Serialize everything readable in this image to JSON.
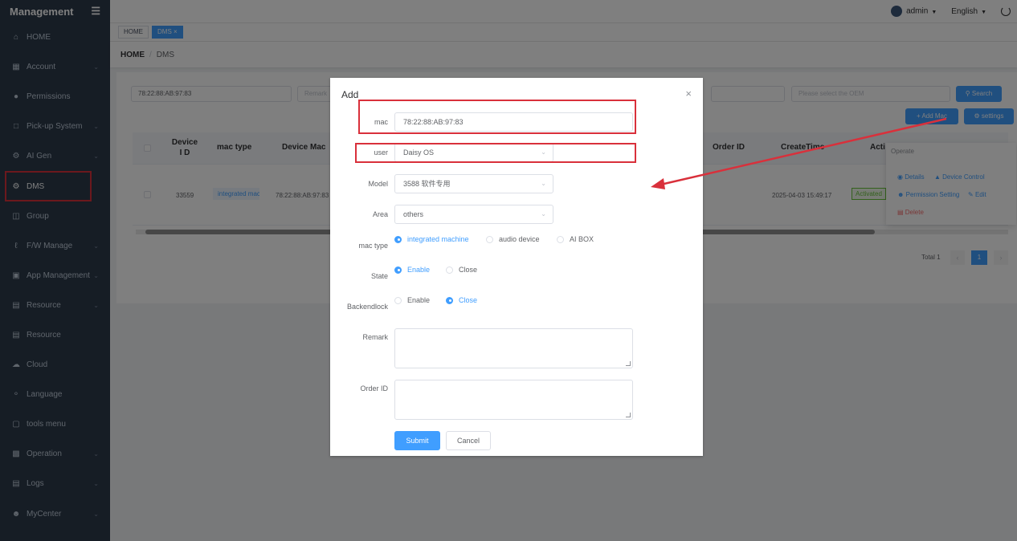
{
  "sidebar": {
    "title": "Management",
    "items": [
      {
        "label": "HOME",
        "icon": "home-icon",
        "chev": false
      },
      {
        "label": "Account",
        "icon": "grid-icon",
        "chev": true
      },
      {
        "label": "Permissions",
        "icon": "user-icon",
        "chev": false
      },
      {
        "label": "Pick-up System",
        "icon": "screen-icon",
        "chev": true
      },
      {
        "label": "AI Gen",
        "icon": "ai-icon",
        "chev": true
      },
      {
        "label": "DMS",
        "icon": "gear-icon",
        "chev": false
      },
      {
        "label": "Group",
        "icon": "folder-icon",
        "chev": false
      },
      {
        "label": "F/W Manage",
        "icon": "wrench-icon",
        "chev": true
      },
      {
        "label": "App Management",
        "icon": "app-icon",
        "chev": true
      },
      {
        "label": "Resource",
        "icon": "stack-icon",
        "chev": true
      },
      {
        "label": "Resource",
        "icon": "stack-icon",
        "chev": false
      },
      {
        "label": "Cloud",
        "icon": "cloud-icon",
        "chev": false
      },
      {
        "label": "Language",
        "icon": "mic-icon",
        "chev": false
      },
      {
        "label": "tools menu",
        "icon": "toolbox-icon",
        "chev": false
      },
      {
        "label": "Operation",
        "icon": "operation-icon",
        "chev": true
      },
      {
        "label": "Logs",
        "icon": "log-icon",
        "chev": true
      },
      {
        "label": "MyCenter",
        "icon": "person-icon",
        "chev": true
      }
    ]
  },
  "topbar": {
    "user": "admin",
    "language": "English"
  },
  "tags": {
    "home": "HOME",
    "dms": "DMS ×"
  },
  "breadcrumb": {
    "home": "HOME",
    "current": "DMS"
  },
  "filters": {
    "mac": "78:22:88:AB:97:83",
    "remark_placeholder": "Remark",
    "oem_placeholder": "Please select the OEM",
    "search": "Search",
    "add_mac": "+ Add Mac",
    "settings": "settings"
  },
  "table": {
    "headers": {
      "device_id": "Device I D",
      "mac_type": "mac type",
      "device_mac": "Device Mac",
      "order_id": "Order ID",
      "create_time": "CreateTime",
      "action": "Acti"
    },
    "row": {
      "device_id": "33559",
      "mac_type": "integrated mac",
      "device_mac": "78:22:88:AB:97:83",
      "create_time": "2025-04-03 15:49:17",
      "status": "Activated"
    }
  },
  "operate_menu": {
    "title": "Operate",
    "details": "Details",
    "device_control": "Device Control",
    "permission_setting": "Permission Setting",
    "edit": "Edit",
    "delete": "Delete"
  },
  "pagination": {
    "total": "Total 1",
    "page": "1"
  },
  "dialog": {
    "title": "Add",
    "mac_label": "mac",
    "mac_value": "78:22:88:AB:97:83",
    "user_label": "user",
    "user_value": "Daisy OS",
    "model_label": "Model",
    "model_value": "3588 软件专用",
    "area_label": "Area",
    "area_value": "others",
    "mactype_label": "mac type",
    "mactype_options": [
      "integrated machine",
      "audio device",
      "AI BOX"
    ],
    "state_label": "State",
    "state_options": [
      "Enable",
      "Close"
    ],
    "backendlock_label": "Backendlock",
    "backendlock_options": [
      "Enable",
      "Close"
    ],
    "remark_label": "Remark",
    "orderid_label": "Order ID",
    "submit": "Submit",
    "cancel": "Cancel"
  },
  "colors": {
    "primary": "#409eff",
    "sidebar": "#2d3a4b",
    "annotation": "#d9303b"
  }
}
